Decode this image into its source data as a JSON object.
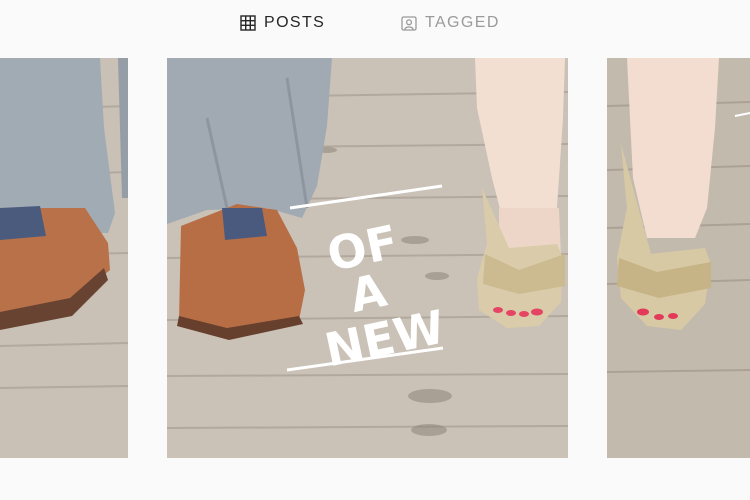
{
  "tabs": [
    {
      "label": "POSTS",
      "icon": "grid-icon",
      "active": true
    },
    {
      "label": "TAGGED",
      "icon": "tagged-portrait-icon",
      "active": false
    }
  ],
  "posts": [
    {
      "description_icon": "photo-left"
    },
    {
      "overlay_text": [
        "OF",
        "A",
        "NEW"
      ]
    },
    {
      "description_icon": "photo-right"
    }
  ],
  "colors": {
    "active_tab": "#262626",
    "inactive_tab": "#9a9a9a",
    "background": "#fafafa",
    "wood": "#b8ab9c",
    "trousers": "#9aa3ad",
    "leather_shoe": "#b4653a",
    "glitter_heel": "#d8c9a5",
    "nail_polish": "#e33a5a"
  }
}
